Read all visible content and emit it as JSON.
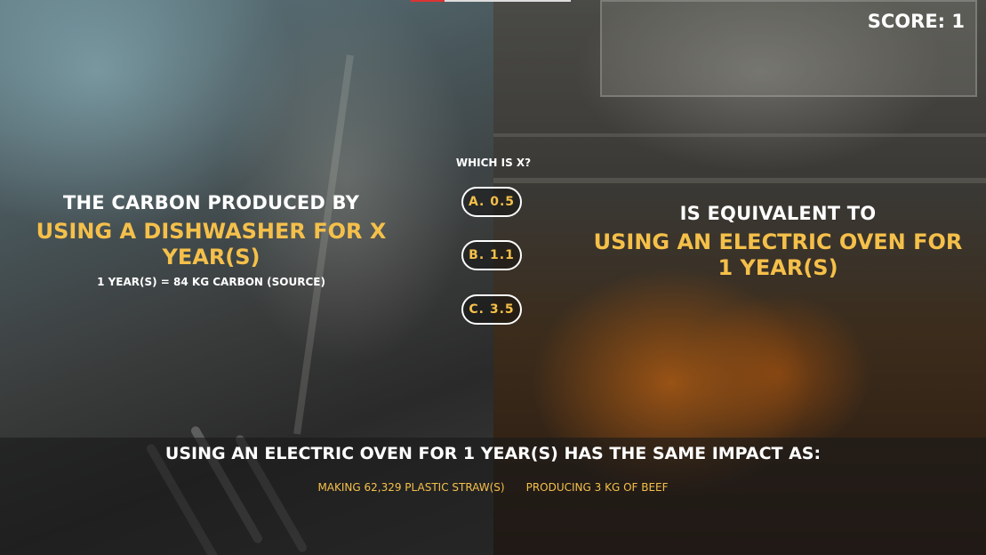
{
  "score_label": "SCORE: 1",
  "left": {
    "lead": "THE CARBON PRODUCED BY",
    "activity": "USING A DISHWASHER FOR X YEAR(S)",
    "source": "1 YEAR(S) = 84 KG CARBON (SOURCE)"
  },
  "question": "WHICH IS X?",
  "answers": [
    {
      "label": "A. 0.5"
    },
    {
      "label": "B. 1.1"
    },
    {
      "label": "C. 3.5"
    }
  ],
  "right": {
    "lead": "IS EQUIVALENT TO",
    "activity": "USING AN ELECTRIC OVEN FOR 1 YEAR(S)"
  },
  "impact": {
    "heading": "USING AN ELECTRIC OVEN FOR 1 YEAR(S) HAS THE SAME IMPACT AS:",
    "items": [
      "MAKING 62,329 PLASTIC STRAW(S)",
      "PRODUCING 3 KG OF BEEF"
    ]
  },
  "colors": {
    "accent": "#f5c04a",
    "text": "#ffffff"
  }
}
